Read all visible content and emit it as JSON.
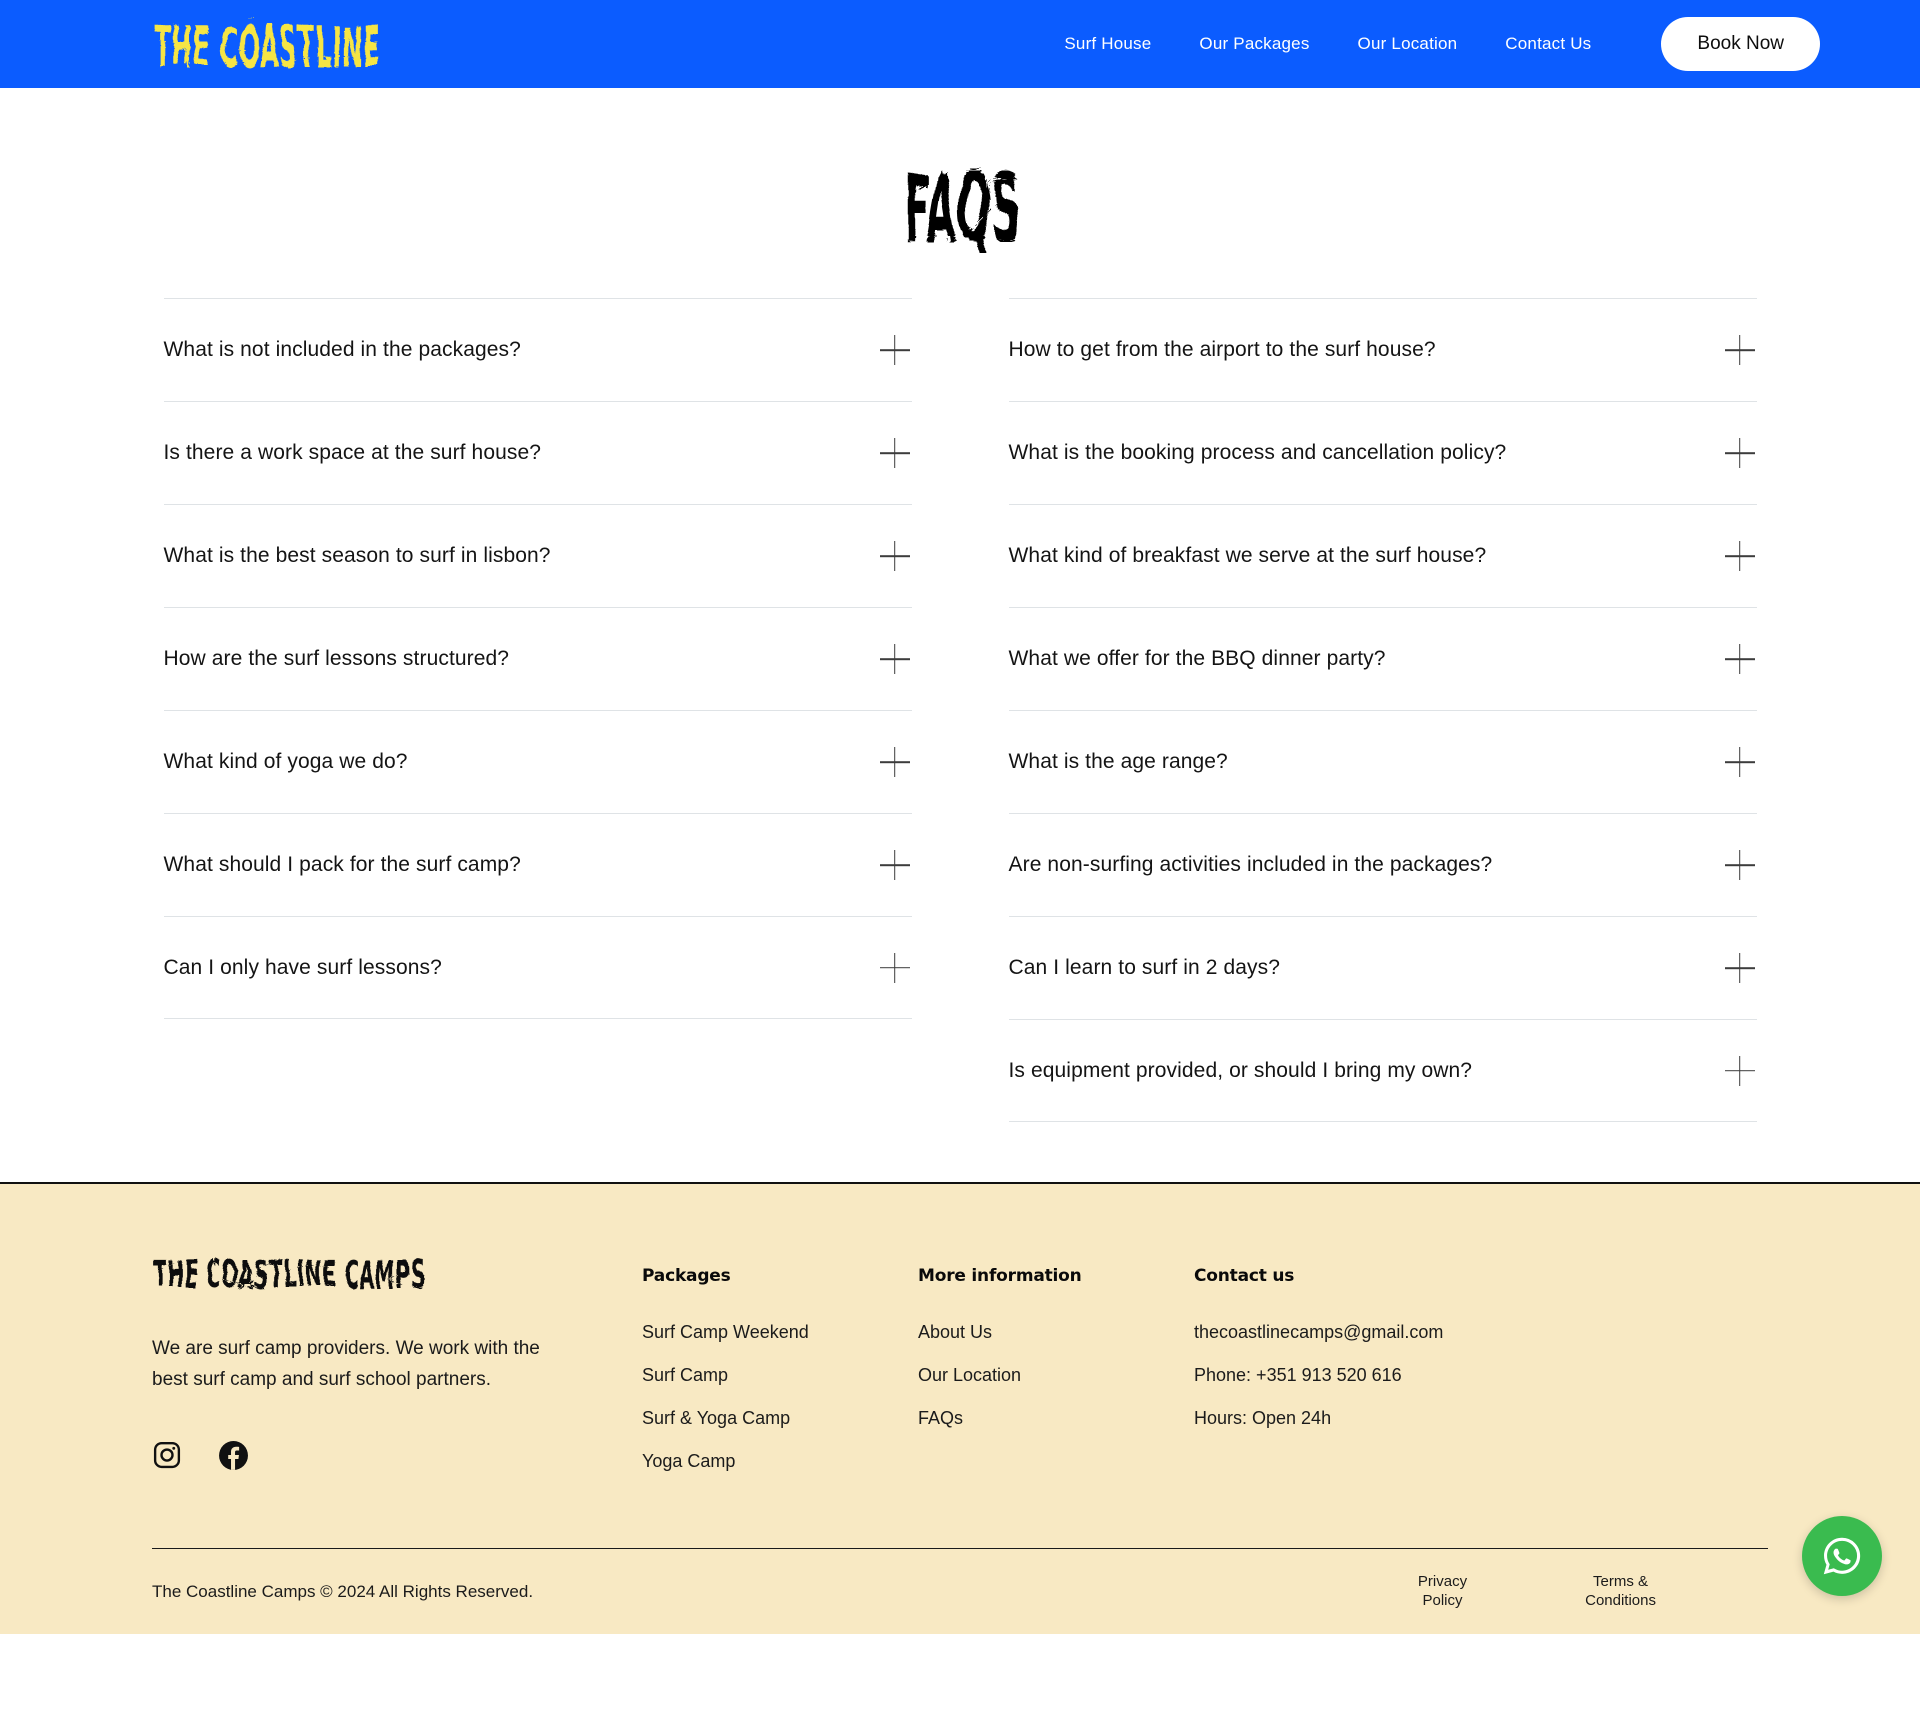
{
  "header": {
    "logo_text": "THE COASTLINE",
    "logo_color": "#F5E545",
    "background_color": "#0B5CFF",
    "nav": [
      {
        "label": "Surf House",
        "name": "nav-link-surf-house"
      },
      {
        "label": "Our Packages",
        "name": "nav-link-our-packages"
      },
      {
        "label": "Our Location",
        "name": "nav-link-our-location"
      },
      {
        "label": "Contact Us",
        "name": "nav-link-contact-us"
      }
    ],
    "cta_label": "Book Now"
  },
  "main": {
    "title": "FAQS",
    "faqs_left": [
      "What is not included in the packages?",
      "Is there a work space at the surf house?",
      "What is the best season to surf in lisbon?",
      "How are the surf lessons structured?",
      "What kind of yoga we do?",
      "What should I pack for the surf camp?",
      "Can I only have surf lessons?"
    ],
    "faqs_right": [
      "How to get from the airport to the surf house?",
      "What is the booking process and cancellation policy?",
      "What kind of breakfast we serve at the surf house?",
      "What we offer for the BBQ dinner party?",
      "What is the age range?",
      "Are non-surfing activities included in the packages?",
      "Can I learn to surf in 2 days?",
      "Is equipment provided, or should I bring my own?"
    ]
  },
  "footer": {
    "background_color": "#F8E9C3",
    "logo_text": "THE COASTLINE CAMPS",
    "description": "We are surf camp providers. We work with the best surf camp and surf school partners.",
    "socials": [
      {
        "name": "instagram-icon"
      },
      {
        "name": "facebook-icon"
      }
    ],
    "packages": {
      "title": "Packages",
      "links": [
        "Surf Camp Weekend",
        "Surf Camp",
        "Surf & Yoga Camp",
        "Yoga Camp"
      ]
    },
    "more_information": {
      "title": "More information",
      "links": [
        "About Us",
        "Our Location",
        "FAQs"
      ]
    },
    "contact": {
      "title": "Contact us",
      "email": "thecoastlinecamps@gmail.com",
      "phone": "Phone: +351 913 520 616",
      "hours": "Hours: Open 24h"
    },
    "copyright": "The Coastline Camps © 2024 All Rights Reserved.",
    "legal": [
      {
        "line1": "Privacy",
        "line2": "Policy"
      },
      {
        "line1": "Terms &",
        "line2": "Conditions"
      }
    ]
  },
  "widgets": {
    "whatsapp": {
      "name": "whatsapp-button",
      "color": "#3ABB4F"
    }
  }
}
